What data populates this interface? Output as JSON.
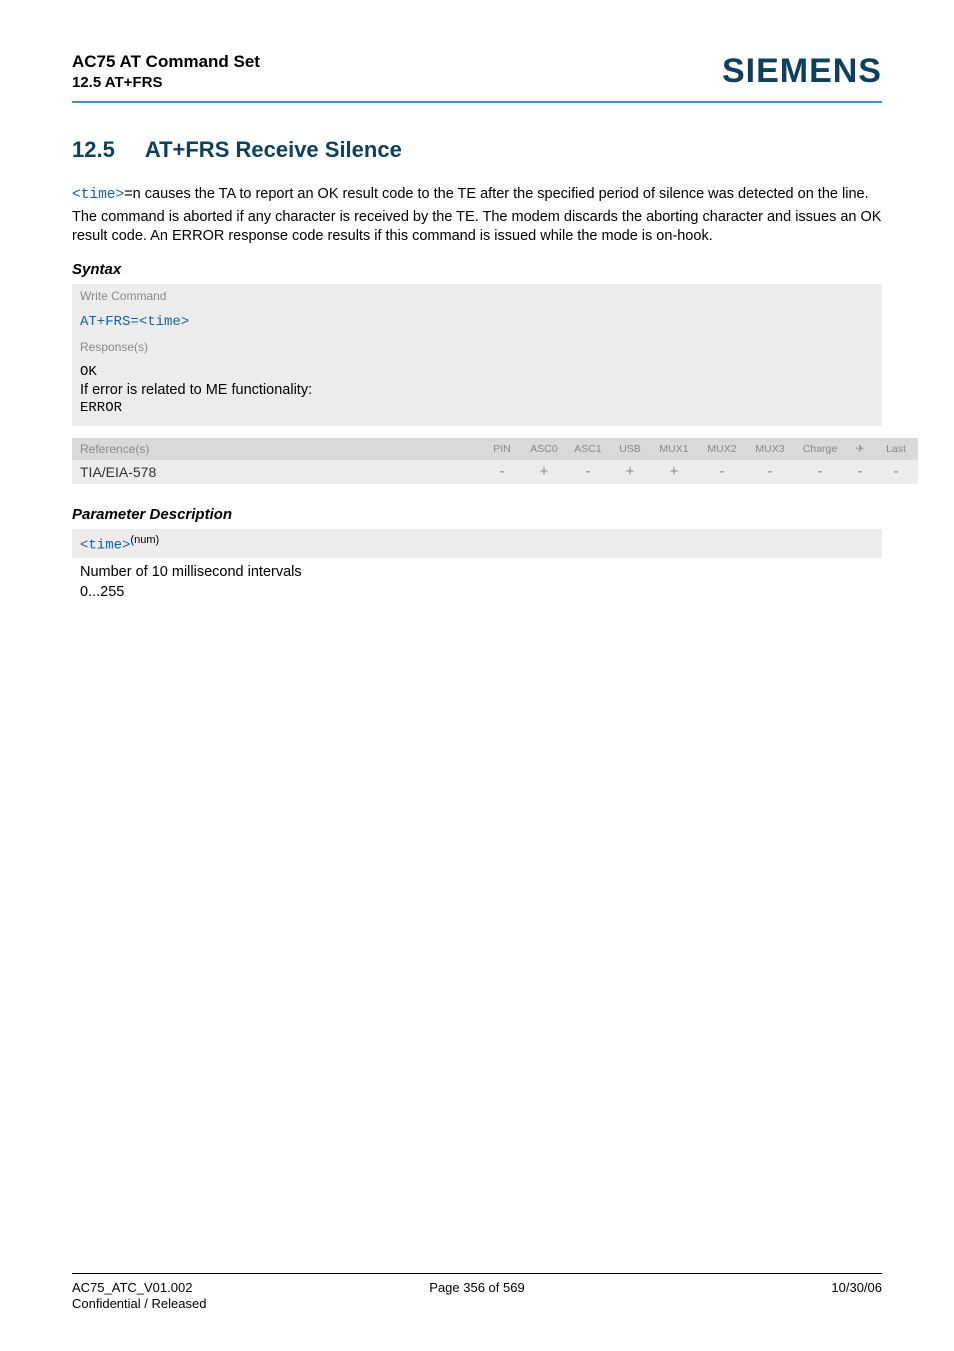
{
  "header": {
    "title_line1": "AC75 AT Command Set",
    "title_line2": "12.5 AT+FRS",
    "brand": "SIEMENS"
  },
  "section": {
    "number": "12.5",
    "title": "AT+FRS   Receive Silence"
  },
  "intro": {
    "code1": "<time>",
    "para1_rest": "=n causes the TA to report an OK result code to the TE after the specified period of silence was detected on the line.",
    "para2": "The command is aborted if any character is received by the TE. The modem discards the aborting character and issues an OK result code. An ERROR response code results if this command is issued while the mode is on-hook."
  },
  "syntax": {
    "heading": "Syntax",
    "write_label": "Write Command",
    "write_cmd_prefix": "AT+FRS=",
    "write_cmd_param": "<time>",
    "responses_label": "Response(s)",
    "resp_ok": "OK",
    "resp_cond": "If error is related to ME functionality:",
    "resp_error": "ERROR"
  },
  "reference": {
    "label": "Reference(s)",
    "value": "TIA/EIA-578",
    "cols": {
      "pin": "PIN",
      "asc0": "ASC0",
      "asc1": "ASC1",
      "usb": "USB",
      "mux1": "MUX1",
      "mux2": "MUX2",
      "mux3": "MUX3",
      "charge": "Charge",
      "arrow": "✈",
      "last": "Last"
    },
    "vals": {
      "pin": "-",
      "asc0": "+",
      "asc1": "-",
      "usb": "+",
      "mux1": "+",
      "mux2": "-",
      "mux3": "-",
      "charge": "-",
      "arrow": "-",
      "last": "-"
    }
  },
  "paramdesc": {
    "heading": "Parameter Description",
    "name": "<time>",
    "sup": "(num)",
    "desc": "Number of 10 millisecond intervals",
    "range": "0...255"
  },
  "footer": {
    "left1": "AC75_ATC_V01.002",
    "left2": "Confidential / Released",
    "center": "Page 356 of 569",
    "right": "10/30/06"
  }
}
